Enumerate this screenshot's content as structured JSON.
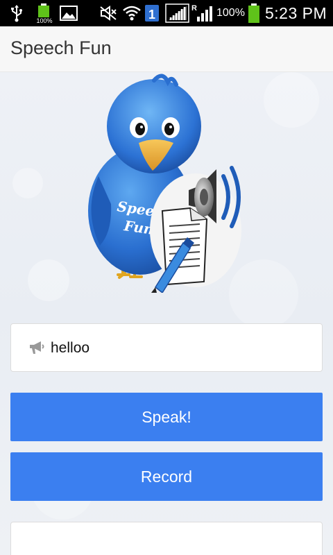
{
  "status_bar": {
    "battery_small_label": "100%",
    "sim_label": "1",
    "roaming_label": "R",
    "battery_percent": "100%",
    "time": "5:23 PM",
    "icons": [
      "usb-icon",
      "battery-icon",
      "image-icon",
      "mute-icon",
      "wifi-icon",
      "sim-icon",
      "signal-icon",
      "signal-icon",
      "battery-icon"
    ]
  },
  "app_bar": {
    "title": "Speech Fun"
  },
  "logo": {
    "text_line1": "Speech",
    "text_line2": "Fun"
  },
  "input": {
    "value": "helloo",
    "icon": "megaphone-icon"
  },
  "buttons": {
    "speak_label": "Speak!",
    "record_label": "Record"
  },
  "colors": {
    "accent": "#3b7ff0",
    "app_bar_bg": "#f7f7f7",
    "status_bar_bg": "#000000",
    "battery_green": "#5fc21a"
  }
}
